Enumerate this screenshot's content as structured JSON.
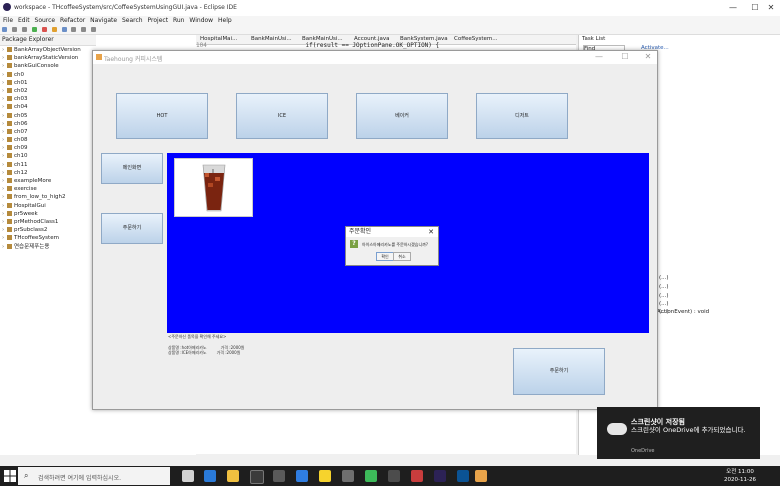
{
  "window": {
    "title": "workspace - THcoffeeSystem/src/CoffeeSystemUsingGUI.java - Eclipse IDE",
    "minimize": "—",
    "maximize": "☐",
    "close": "✕"
  },
  "menu": [
    "File",
    "Edit",
    "Source",
    "Refactor",
    "Navigate",
    "Search",
    "Project",
    "Run",
    "Window",
    "Help"
  ],
  "package_explorer": {
    "title": "Package Explorer",
    "items": [
      "BankArrayObjectVersion",
      "bankArrayStaticVersion",
      "bankGuiConsole",
      "ch0",
      "ch01",
      "ch02",
      "ch03",
      "ch04",
      "ch05",
      "ch06",
      "ch07",
      "ch08",
      "ch09",
      "ch10",
      "ch11",
      "ch12",
      "exampleMore",
      "exercise",
      "from_low_to_high2",
      "HospitalGui",
      "pr5week",
      "prMethodClass1",
      "prSubclass2",
      "THcoffeeSystem",
      "연습문제푸는용"
    ]
  },
  "editor": {
    "tabs": [
      "HospitalMai...",
      "BankMainUsi...",
      "BankMainUsi...",
      "Account.java",
      "BankSystem.java",
      "CoffeeSystem..."
    ],
    "line_no": "104",
    "code": "if(result == JOptionPane.OK_OPTION) {"
  },
  "task_list": {
    "title": "Task List",
    "find": "Find",
    "activate": "Activate...",
    "outline": [
      "(...)",
      "(...)",
      "(...)",
      "(...)",
      "(...)",
      "ActionEvent) : void"
    ]
  },
  "swing": {
    "title": "Taehoung 커피시스템",
    "buttons_top": [
      "HOT",
      "ICE",
      "베이커",
      "디저트"
    ],
    "buttons_left": [
      "메인화면",
      "주문하기"
    ],
    "status": "<주문하신 품목을 확인해 주세요>",
    "order_lines": [
      {
        "item": "상품명 :hot아메리카노",
        "price": "가격 :2000원"
      },
      {
        "item": "상품명 :ICE아메리카노",
        "price": "가격 :2000원"
      }
    ],
    "checkout_label": "주문하기"
  },
  "dialog": {
    "title": "주문확인",
    "close": "✕",
    "icon": "?",
    "message": "아이스아메리카노를 주문하시겠습니까?",
    "ok": "확인",
    "cancel": "취소"
  },
  "toast": {
    "title": "스크린샷이 저장됨",
    "body": "스크린샷이 OneDrive에 추가되었습니다.",
    "source": "OneDrive"
  },
  "taskbar": {
    "search_placeholder": "검색하려면 여기에 입력하십시오.",
    "time": "오전 11:00",
    "date": "2020-11-26"
  },
  "colors": {
    "blue_panel": "#0000ff",
    "eclipse_purple": "#2c2255"
  }
}
